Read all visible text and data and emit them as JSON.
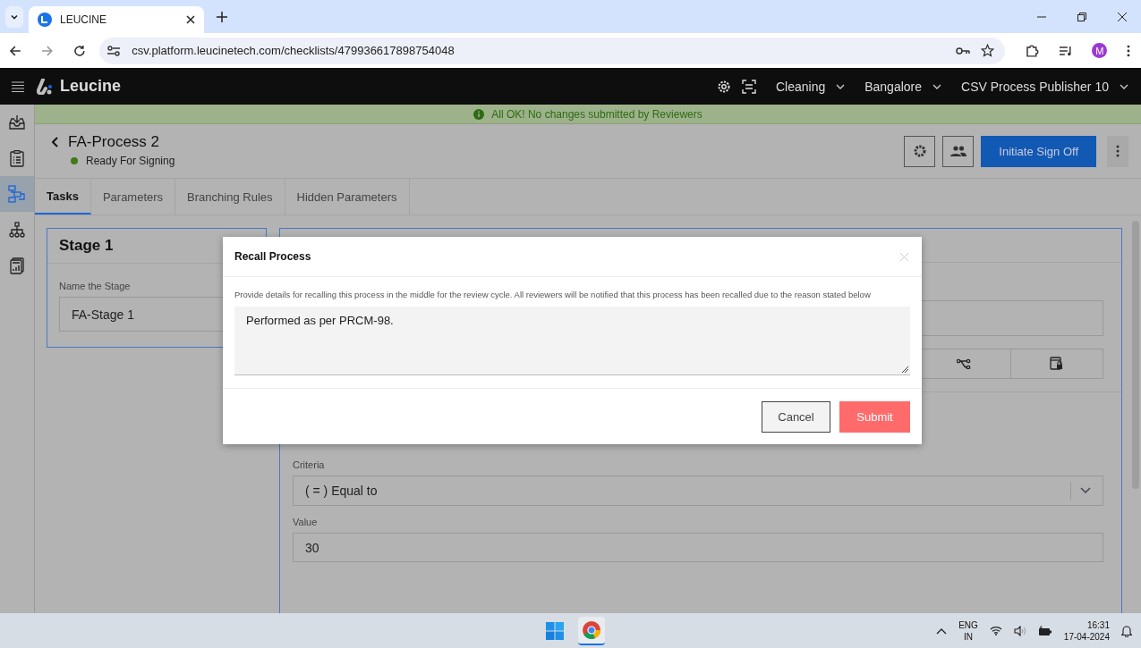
{
  "browser": {
    "tab_title": "LEUCINE",
    "url": "csv.platform.leucinetech.com/checklists/479936617898754048",
    "avatar": "M"
  },
  "header": {
    "brand": "Leucine",
    "selectors": [
      "Cleaning",
      "Bangalore",
      "CSV Process Publisher 10"
    ]
  },
  "banner": {
    "message": "All OK! No changes submitted by Reviewers"
  },
  "sidebar": {
    "items": [
      {
        "selected": false
      },
      {
        "selected": false
      },
      {
        "selected": true
      },
      {
        "selected": false
      },
      {
        "selected": false
      }
    ]
  },
  "process": {
    "title": "FA-Process 2",
    "status": "Ready For Signing",
    "primary_button": "Initiate Sign Off"
  },
  "tabs": [
    {
      "label": "Tasks",
      "selected": true
    },
    {
      "label": "Parameters",
      "selected": false
    },
    {
      "label": "Branching Rules",
      "selected": false
    },
    {
      "label": "Hidden Parameters",
      "selected": false
    }
  ],
  "stage": {
    "title": "Stage 1",
    "label": "Name the Stage",
    "value": "FA-Stage 1"
  },
  "task": {
    "criteria_label": "Criteria",
    "criteria_value": "( = ) Equal to",
    "value_label": "Value",
    "value": "30"
  },
  "modal": {
    "title": "Recall Process",
    "description": "Provide details for recalling this process in the middle for the review cycle. All reviewers will be notified that this process has been recalled due to the reason stated below",
    "reason": "Performed as per PRCM-98.",
    "cancel": "Cancel",
    "submit": "Submit"
  },
  "taskbar": {
    "language": "ENG",
    "region": "IN",
    "time": "16:31",
    "date": "17-04-2024"
  }
}
